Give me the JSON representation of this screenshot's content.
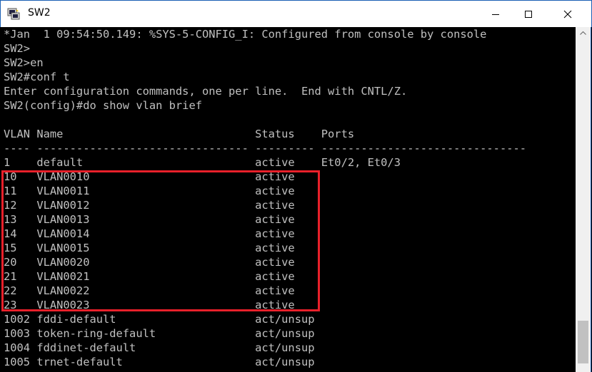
{
  "window": {
    "title": "SW2",
    "colors": {
      "title_bg": "#ffffff",
      "terminal_bg": "#000000",
      "terminal_fg": "#c0c0c0",
      "highlight": "#e8202a"
    }
  },
  "terminal": {
    "lines": [
      "*Jan  1 09:54:50.149: %SYS-5-CONFIG_I: Configured from console by console",
      "SW2>",
      "SW2>en",
      "SW2#conf t",
      "Enter configuration commands, one per line.  End with CNTL/Z.",
      "SW2(config)#do show vlan brief",
      "",
      "VLAN Name                             Status    Ports",
      "---- -------------------------------- --------- -------------------------------",
      "1    default                          active    Et0/2, Et0/3",
      "10   VLAN0010                         active",
      "11   VLAN0011                         active",
      "12   VLAN0012                         active",
      "13   VLAN0013                         active",
      "14   VLAN0014                         active",
      "15   VLAN0015                         active",
      "20   VLAN0020                         active",
      "21   VLAN0021                         active",
      "22   VLAN0022                         active",
      "23   VLAN0023                         active",
      "1002 fddi-default                     act/unsup",
      "1003 token-ring-default               act/unsup",
      "1004 fddinet-default                  act/unsup",
      "1005 trnet-default                    act/unsup"
    ]
  }
}
